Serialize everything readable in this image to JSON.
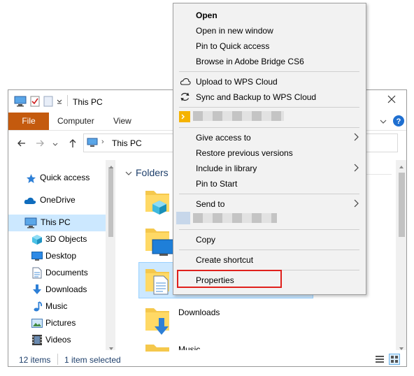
{
  "window": {
    "title": "This PC",
    "ribbon_tabs": [
      "File",
      "Computer",
      "View"
    ],
    "address": "This PC",
    "sidebar": [
      {
        "label": "Quick access",
        "icon": "star-icon"
      },
      {
        "label": "OneDrive",
        "icon": "cloud-icon"
      },
      {
        "label": "This PC",
        "icon": "computer-icon"
      },
      {
        "label": "3D Objects",
        "icon": "cube-icon"
      },
      {
        "label": "Desktop",
        "icon": "desktop-icon"
      },
      {
        "label": "Documents",
        "icon": "documents-icon"
      },
      {
        "label": "Downloads",
        "icon": "download-icon"
      },
      {
        "label": "Music",
        "icon": "music-icon"
      },
      {
        "label": "Pictures",
        "icon": "pictures-icon"
      },
      {
        "label": "Videos",
        "icon": "videos-icon"
      }
    ],
    "section_header": "Folders",
    "folder_labels": [
      "Downloads",
      "Music"
    ],
    "status": {
      "count": "12 items",
      "selected": "1 item selected"
    }
  },
  "menu": {
    "items": [
      "Open",
      "Open in new window",
      "Pin to Quick access",
      "Browse in Adobe Bridge CS6",
      "Upload to WPS Cloud",
      "Sync and Backup to WPS Cloud",
      "Give access to",
      "Restore previous versions",
      "Include in library",
      "Pin to Start",
      "Send to",
      "Copy",
      "Create shortcut",
      "Properties"
    ]
  },
  "colors": {
    "accent": "#c45a0e",
    "highlight": "#e0201c",
    "selection": "#cce8ff",
    "help": "#1f6fd0"
  }
}
